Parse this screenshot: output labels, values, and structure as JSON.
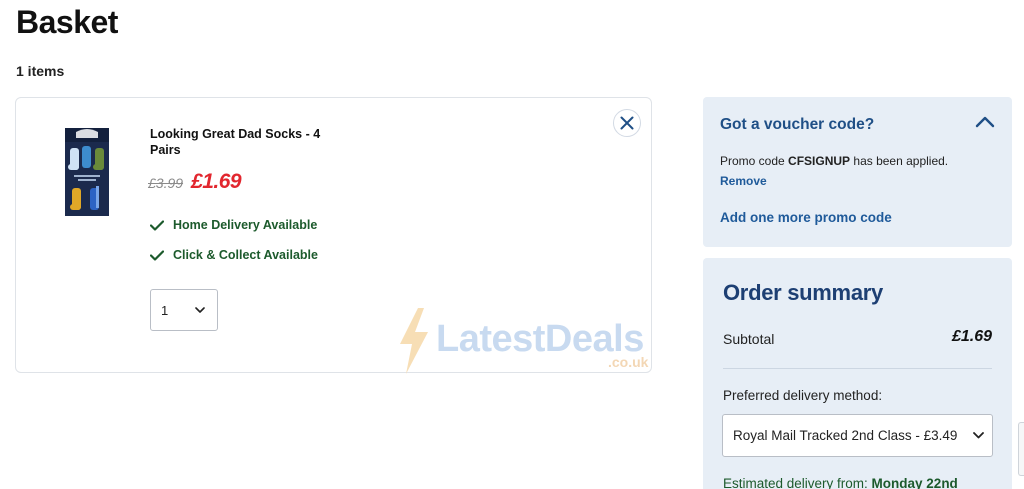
{
  "page": {
    "title": "Basket",
    "items_count": "1 items"
  },
  "basket_item": {
    "name": "Looking Great Dad Socks - 4 Pairs",
    "old_price": "£3.99",
    "price": "£1.69",
    "availability": [
      "Home Delivery Available",
      "Click & Collect Available"
    ],
    "quantity": "1",
    "image_label": "LOOKING GREAT DAD"
  },
  "watermark": {
    "text": "LatestDeals",
    "sub": ".co.uk"
  },
  "voucher": {
    "title": "Got a voucher code?",
    "promo_prefix": "Promo code ",
    "promo_code": "CFSIGNUP",
    "promo_suffix": " has been applied.",
    "remove_label": "Remove",
    "add_label": "Add one more promo code"
  },
  "summary": {
    "title": "Order summary",
    "subtotal_label": "Subtotal",
    "subtotal_value": "£1.69",
    "delivery_label": "Preferred delivery method:",
    "delivery_selected": "Royal Mail Tracked 2nd Class - £3.49",
    "estimate_prefix": "Estimated delivery from: ",
    "estimate_date": "Monday 22nd"
  },
  "colors": {
    "accent_blue": "#1f4f86",
    "price_red": "#e2262e",
    "availability_green": "#1c5a2c",
    "panel_bg": "#e7eef6"
  },
  "icons": {
    "remove_item": "close-icon",
    "voucher_toggle": "chevron-up-icon",
    "select_arrow": "chevron-down-icon",
    "availability": "checkmark-icon",
    "watermark": "lightning-bolt-icon"
  }
}
